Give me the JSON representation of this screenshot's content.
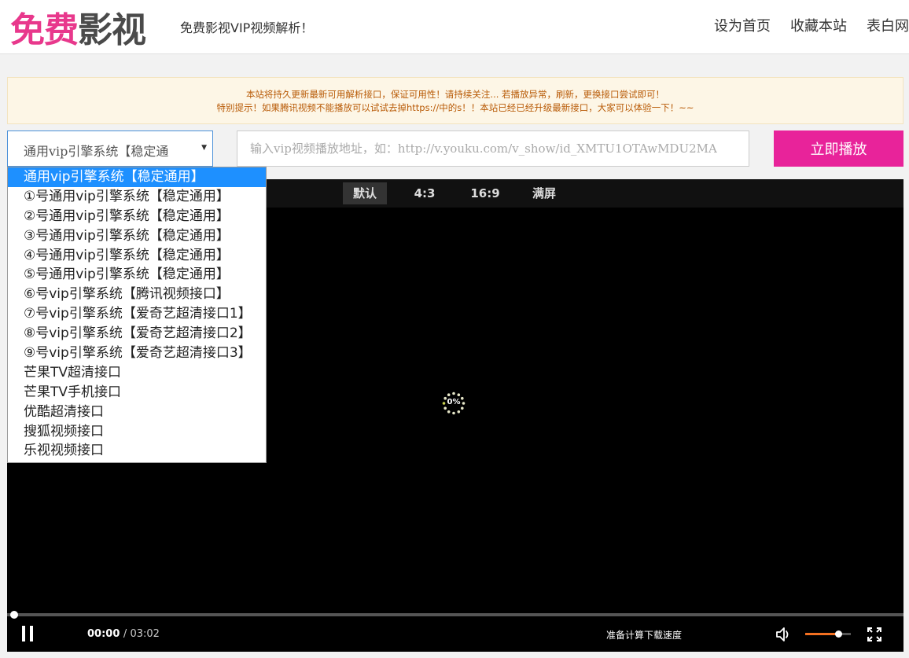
{
  "header": {
    "logo_a": "免费",
    "logo_b": "影视",
    "tagline": "免费影视VIP视频解析！",
    "nav": [
      "设为首页",
      "收藏本站",
      "表白网"
    ]
  },
  "notice": {
    "line1": "本站将持久更新最新可用解析接口，保证可用性！请持续关注... 若播放异常，刷新，更换接口尝试即可！",
    "line2": "特别提示！如果腾讯视频不能播放可以试试去掉https://中的s！！本站已经已经升级最新接口，大家可以体验一下！~~"
  },
  "controls": {
    "select_value": "通用vip引擎系统【稳定通",
    "url_placeholder": "输入vip视频播放地址，如：http://v.youku.com/v_show/id_XMTU1OTAwMDU2MA",
    "play_label": "立即播放"
  },
  "dropdown": {
    "options": [
      "通用vip引擎系统【稳定通用】",
      "①号通用vip引擎系统【稳定通用】",
      "②号通用vip引擎系统【稳定通用】",
      "③号通用vip引擎系统【稳定通用】",
      "④号通用vip引擎系统【稳定通用】",
      "⑤号通用vip引擎系统【稳定通用】",
      "⑥号vip引擎系统【腾讯视频接口】",
      "⑦号vip引擎系统【爱奇艺超清接口1】",
      "⑧号vip引擎系统【爱奇艺超清接口2】",
      "⑨号vip引擎系统【爱奇艺超清接口3】",
      "芒果TV超清接口",
      "芒果TV手机接口",
      "优酷超清接口",
      "搜狐视频接口",
      "乐视视频接口"
    ],
    "selected_index": 0
  },
  "player": {
    "ratios": [
      "默认",
      "4:3",
      "16:9",
      "满屏"
    ],
    "active_ratio": 0,
    "loading": "0%",
    "current_time": "00:00",
    "total_time": "03:02",
    "speed_text": "准备计算下载速度",
    "progress": 0,
    "volume": 0.7
  },
  "colors": {
    "brand_pink": "#e8239a",
    "select_highlight": "#1e90ff",
    "volume_accent": "#f37021",
    "notice_text": "#b85a06"
  },
  "icons": [
    "pause-icon",
    "volume-icon",
    "fullscreen-icon",
    "loading-spinner-icon",
    "dropdown-arrow-icon"
  ]
}
